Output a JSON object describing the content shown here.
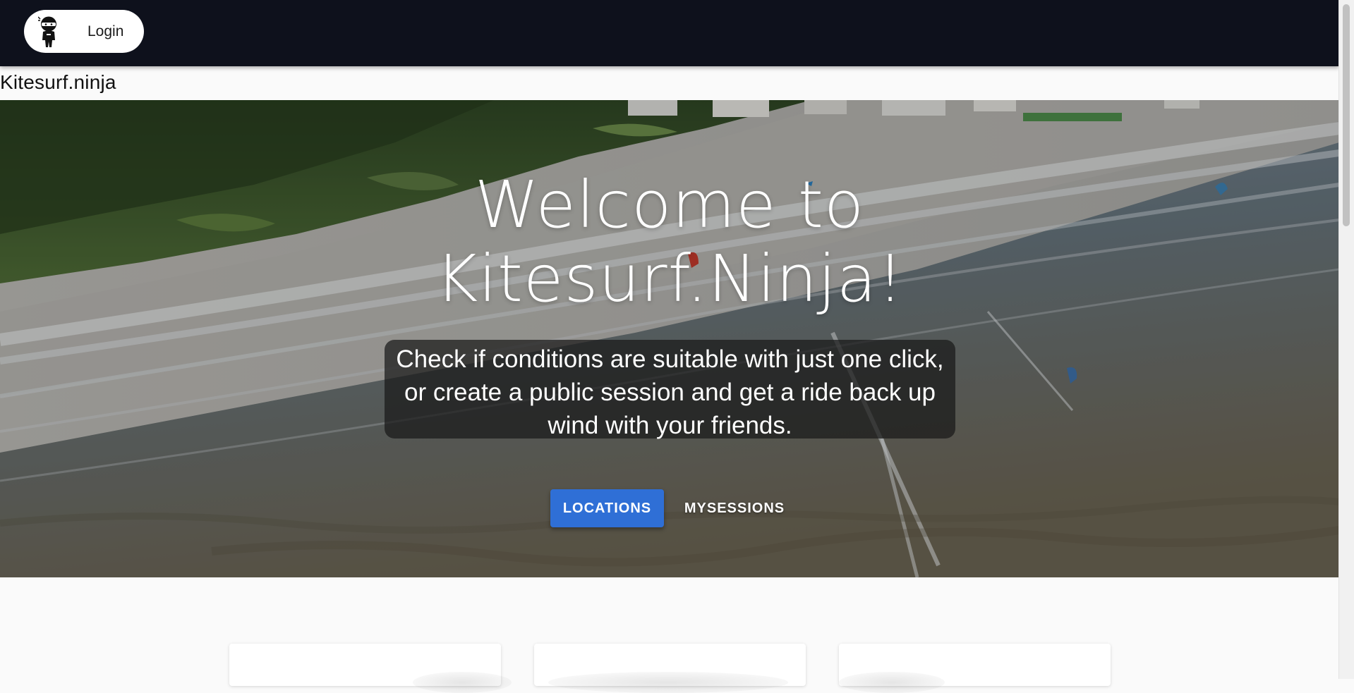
{
  "header": {
    "login_label": "Login",
    "avatar_icon": "ninja-avatar-icon",
    "background_color": "#0e111c"
  },
  "brand": {
    "title": "Kitesurf.ninja"
  },
  "hero": {
    "title_line1": "Welcome to",
    "title_line2": "Kitesurf.Ninja!",
    "subtitle": "Check if conditions are suitable with just one click, or create a public session and get a ride back up wind with your friends.",
    "buttons": {
      "locations_label": "LOCATIONS",
      "mysessions_label": "MYSESSIONS"
    },
    "accent_color": "#2f6fd6"
  }
}
